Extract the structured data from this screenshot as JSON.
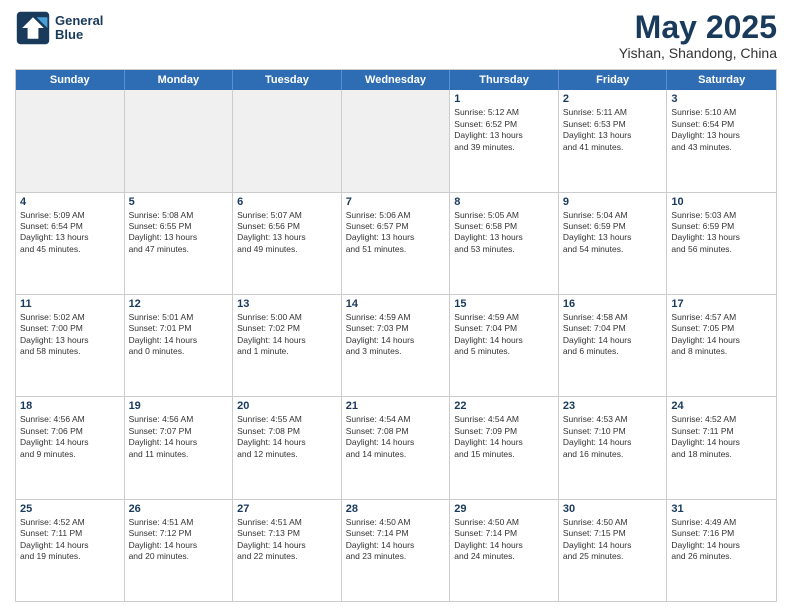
{
  "logo": {
    "line1": "General",
    "line2": "Blue"
  },
  "title": "May 2025",
  "subtitle": "Yishan, Shandong, China",
  "header_days": [
    "Sunday",
    "Monday",
    "Tuesday",
    "Wednesday",
    "Thursday",
    "Friday",
    "Saturday"
  ],
  "weeks": [
    [
      {
        "day": "",
        "info": ""
      },
      {
        "day": "",
        "info": ""
      },
      {
        "day": "",
        "info": ""
      },
      {
        "day": "",
        "info": ""
      },
      {
        "day": "1",
        "info": "Sunrise: 5:12 AM\nSunset: 6:52 PM\nDaylight: 13 hours\nand 39 minutes."
      },
      {
        "day": "2",
        "info": "Sunrise: 5:11 AM\nSunset: 6:53 PM\nDaylight: 13 hours\nand 41 minutes."
      },
      {
        "day": "3",
        "info": "Sunrise: 5:10 AM\nSunset: 6:54 PM\nDaylight: 13 hours\nand 43 minutes."
      }
    ],
    [
      {
        "day": "4",
        "info": "Sunrise: 5:09 AM\nSunset: 6:54 PM\nDaylight: 13 hours\nand 45 minutes."
      },
      {
        "day": "5",
        "info": "Sunrise: 5:08 AM\nSunset: 6:55 PM\nDaylight: 13 hours\nand 47 minutes."
      },
      {
        "day": "6",
        "info": "Sunrise: 5:07 AM\nSunset: 6:56 PM\nDaylight: 13 hours\nand 49 minutes."
      },
      {
        "day": "7",
        "info": "Sunrise: 5:06 AM\nSunset: 6:57 PM\nDaylight: 13 hours\nand 51 minutes."
      },
      {
        "day": "8",
        "info": "Sunrise: 5:05 AM\nSunset: 6:58 PM\nDaylight: 13 hours\nand 53 minutes."
      },
      {
        "day": "9",
        "info": "Sunrise: 5:04 AM\nSunset: 6:59 PM\nDaylight: 13 hours\nand 54 minutes."
      },
      {
        "day": "10",
        "info": "Sunrise: 5:03 AM\nSunset: 6:59 PM\nDaylight: 13 hours\nand 56 minutes."
      }
    ],
    [
      {
        "day": "11",
        "info": "Sunrise: 5:02 AM\nSunset: 7:00 PM\nDaylight: 13 hours\nand 58 minutes."
      },
      {
        "day": "12",
        "info": "Sunrise: 5:01 AM\nSunset: 7:01 PM\nDaylight: 14 hours\nand 0 minutes."
      },
      {
        "day": "13",
        "info": "Sunrise: 5:00 AM\nSunset: 7:02 PM\nDaylight: 14 hours\nand 1 minute."
      },
      {
        "day": "14",
        "info": "Sunrise: 4:59 AM\nSunset: 7:03 PM\nDaylight: 14 hours\nand 3 minutes."
      },
      {
        "day": "15",
        "info": "Sunrise: 4:59 AM\nSunset: 7:04 PM\nDaylight: 14 hours\nand 5 minutes."
      },
      {
        "day": "16",
        "info": "Sunrise: 4:58 AM\nSunset: 7:04 PM\nDaylight: 14 hours\nand 6 minutes."
      },
      {
        "day": "17",
        "info": "Sunrise: 4:57 AM\nSunset: 7:05 PM\nDaylight: 14 hours\nand 8 minutes."
      }
    ],
    [
      {
        "day": "18",
        "info": "Sunrise: 4:56 AM\nSunset: 7:06 PM\nDaylight: 14 hours\nand 9 minutes."
      },
      {
        "day": "19",
        "info": "Sunrise: 4:56 AM\nSunset: 7:07 PM\nDaylight: 14 hours\nand 11 minutes."
      },
      {
        "day": "20",
        "info": "Sunrise: 4:55 AM\nSunset: 7:08 PM\nDaylight: 14 hours\nand 12 minutes."
      },
      {
        "day": "21",
        "info": "Sunrise: 4:54 AM\nSunset: 7:08 PM\nDaylight: 14 hours\nand 14 minutes."
      },
      {
        "day": "22",
        "info": "Sunrise: 4:54 AM\nSunset: 7:09 PM\nDaylight: 14 hours\nand 15 minutes."
      },
      {
        "day": "23",
        "info": "Sunrise: 4:53 AM\nSunset: 7:10 PM\nDaylight: 14 hours\nand 16 minutes."
      },
      {
        "day": "24",
        "info": "Sunrise: 4:52 AM\nSunset: 7:11 PM\nDaylight: 14 hours\nand 18 minutes."
      }
    ],
    [
      {
        "day": "25",
        "info": "Sunrise: 4:52 AM\nSunset: 7:11 PM\nDaylight: 14 hours\nand 19 minutes."
      },
      {
        "day": "26",
        "info": "Sunrise: 4:51 AM\nSunset: 7:12 PM\nDaylight: 14 hours\nand 20 minutes."
      },
      {
        "day": "27",
        "info": "Sunrise: 4:51 AM\nSunset: 7:13 PM\nDaylight: 14 hours\nand 22 minutes."
      },
      {
        "day": "28",
        "info": "Sunrise: 4:50 AM\nSunset: 7:14 PM\nDaylight: 14 hours\nand 23 minutes."
      },
      {
        "day": "29",
        "info": "Sunrise: 4:50 AM\nSunset: 7:14 PM\nDaylight: 14 hours\nand 24 minutes."
      },
      {
        "day": "30",
        "info": "Sunrise: 4:50 AM\nSunset: 7:15 PM\nDaylight: 14 hours\nand 25 minutes."
      },
      {
        "day": "31",
        "info": "Sunrise: 4:49 AM\nSunset: 7:16 PM\nDaylight: 14 hours\nand 26 minutes."
      }
    ]
  ],
  "colors": {
    "header_bg": "#2e6db4",
    "header_text": "#ffffff",
    "title_color": "#1a3a5c",
    "shaded_bg": "#f0f0f0",
    "cell_border": "#cccccc"
  }
}
